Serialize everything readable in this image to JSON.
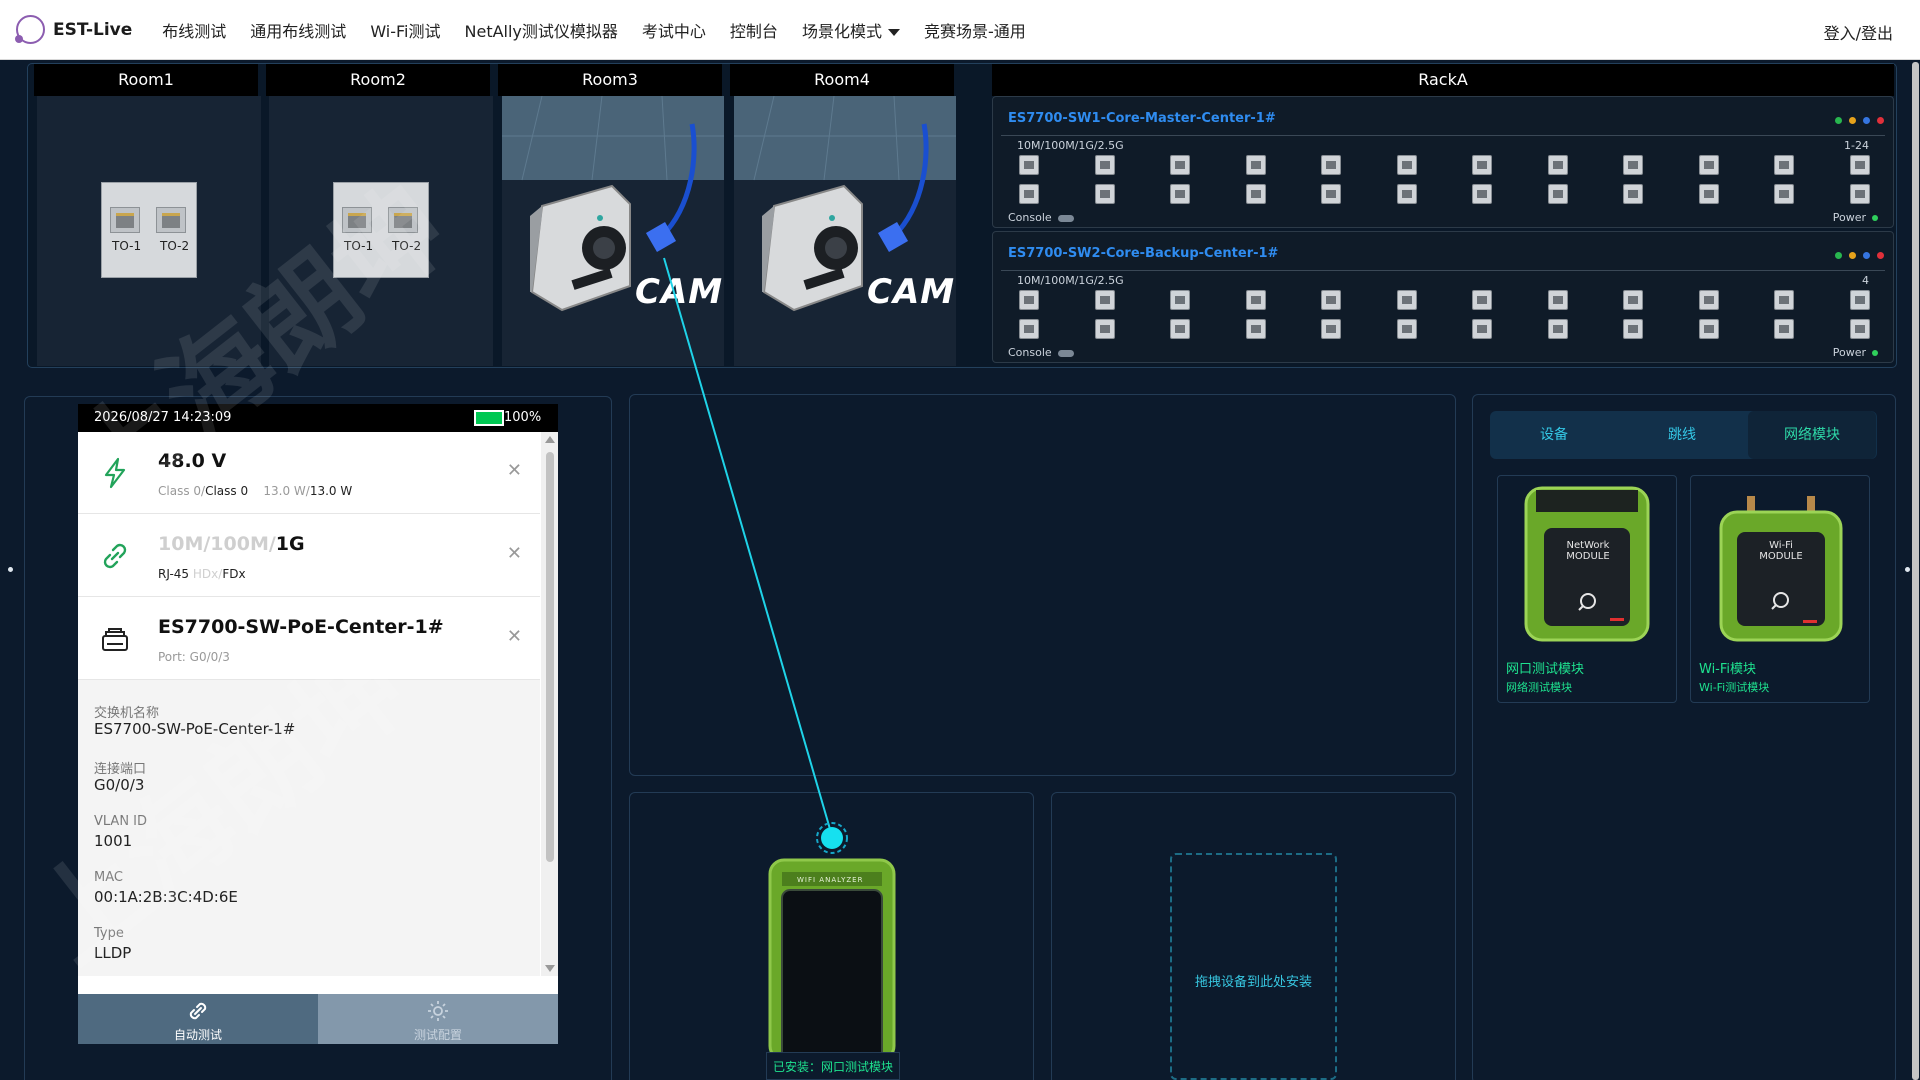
{
  "app": {
    "brand": "EST-Live"
  },
  "nav": {
    "items": [
      "布线测试",
      "通用布线测试",
      "Wi-Fi测试",
      "NetAlly测试仪模拟器",
      "考试中心",
      "控制台",
      "场景化模式",
      "竞赛场景-通用"
    ],
    "login": "登入/登出"
  },
  "rooms": [
    {
      "name": "Room1",
      "content": "outlet",
      "outlets": [
        "TO-1",
        "TO-2"
      ]
    },
    {
      "name": "Room2",
      "content": "outlet",
      "outlets": [
        "TO-1",
        "TO-2"
      ]
    },
    {
      "name": "Room3",
      "content": "camera",
      "camera_label": "CAM"
    },
    {
      "name": "Room4",
      "content": "camera",
      "camera_label": "CAM"
    }
  ],
  "rack": {
    "name": "RackA",
    "switches": [
      {
        "name": "ES7700-SW1-Core-Master-Center-1#",
        "spec": "10M/100M/1G/2.5G",
        "range": "1-24",
        "console": "Console",
        "power": "Power"
      },
      {
        "name": "ES7700-SW2-Core-Backup-Center-1#",
        "spec": "10M/100M/1G/2.5G",
        "range": "4",
        "console": "Console",
        "power": "Power"
      }
    ],
    "led_colors": [
      "#28b64f",
      "#e6a21b",
      "#3575e0",
      "#e0303a"
    ]
  },
  "tester": {
    "datetime": "2026/08/27 14:23:09",
    "battery": "100%",
    "battery_level": 1.0,
    "cards": {
      "poe": {
        "value": "48.0 V",
        "class_a": "Class 0/",
        "class_b": "Class 0",
        "power_a": "13.0 W/",
        "power_b": "13.0 W"
      },
      "link": {
        "speed_dim": "10M/100M/",
        "speed_active": "1G",
        "media": "RJ-45",
        "duplex_dim": "HDx/",
        "duplex_active": "FDx"
      },
      "switch": {
        "name": "ES7700-SW-PoE-Center-1#",
        "port": "Port: G0/0/3"
      }
    },
    "details": [
      {
        "label": "交换机名称",
        "value": "ES7700-SW-PoE-Center-1#"
      },
      {
        "label": "连接端口",
        "value": "G0/0/3"
      },
      {
        "label": "VLAN ID",
        "value": "1001"
      },
      {
        "label": "MAC",
        "value": "00:1A:2B:3C:4D:6E"
      },
      {
        "label": "Type",
        "value": "LLDP"
      }
    ],
    "tabs": {
      "auto": "自动测试",
      "config": "测试配置"
    }
  },
  "device_tabs": [
    "设备",
    "跳线",
    "网络模块"
  ],
  "modules": [
    {
      "title": "网口测试模块",
      "sub": "网络测试模块",
      "device_text": "NetWork MODULE"
    },
    {
      "title": "Wi-Fi模块",
      "sub": "Wi-Fi测试模块",
      "device_text": "Wi-Fi MODULE"
    }
  ],
  "analyzer": {
    "label": "WIFI ANALYZER",
    "installed": "已安装：网口测试模块"
  },
  "drop_zone": "拖拽设备到此处安装",
  "watermark": "上海朗坤",
  "colors": {
    "accent": "#1fc8e3",
    "module_green": "#1ee28f",
    "link_blue": "#2f8cf0"
  }
}
